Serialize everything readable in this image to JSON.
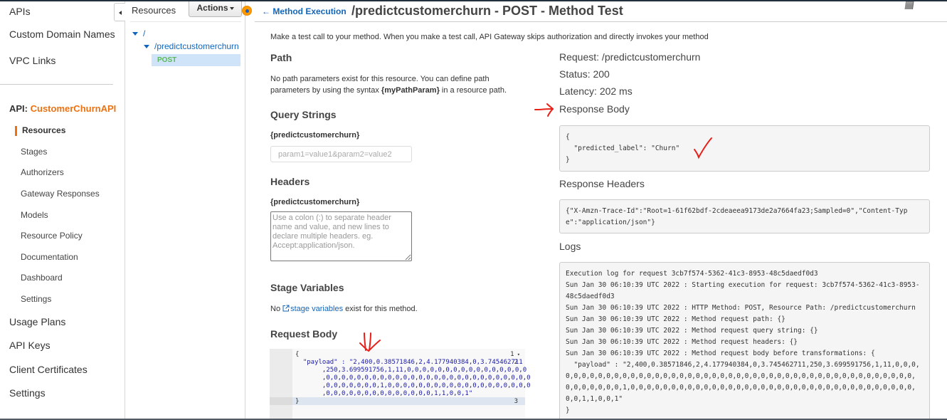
{
  "left_nav": {
    "top_items": [
      "APIs",
      "Custom Domain Names",
      "VPC Links"
    ],
    "api_prefix": "API:",
    "api_name": "CustomerChurnAPI",
    "sub_items": [
      "Resources",
      "Stages",
      "Authorizers",
      "Gateway Responses",
      "Models",
      "Resource Policy",
      "Documentation",
      "Dashboard",
      "Settings"
    ],
    "active_sub_item": "Resources",
    "bottom_items": [
      "Usage Plans",
      "API Keys",
      "Client Certificates",
      "Settings"
    ]
  },
  "resources_panel": {
    "title": "Resources",
    "actions_label": "Actions",
    "tree": [
      {
        "label": "/",
        "level": 0,
        "expanded": true
      },
      {
        "label": "/predictcustomerchurn",
        "level": 1,
        "expanded": true
      },
      {
        "label": "POST",
        "level": 2,
        "selected": true
      }
    ]
  },
  "header": {
    "back_label": "Method Execution",
    "title": "/predictcustomerchurn - POST - Method Test",
    "intro": "Make a test call to your method. When you make a test call, API Gateway skips authorization and directly invokes your method"
  },
  "form": {
    "path": {
      "heading": "Path",
      "text_before": "No path parameters exist for this resource. You can define path parameters by using the syntax ",
      "syntax": "{myPathParam}",
      "text_after": " in a resource path."
    },
    "query_strings": {
      "heading": "Query Strings",
      "resource": "{predictcustomerchurn}",
      "placeholder": "param1=value1&param2=value2",
      "value": ""
    },
    "headers": {
      "heading": "Headers",
      "resource": "{predictcustomerchurn}",
      "placeholder": "Use a colon (:) to separate header name and value, and new lines to declare multiple headers. eg. Accept:application/json.",
      "value": ""
    },
    "stage_variables": {
      "heading": "Stage Variables",
      "text_before": "No ",
      "link": "stage variables",
      "text_after": " exist for this method."
    },
    "request_body": {
      "heading": "Request Body",
      "line_numbers": [
        "1",
        "2",
        "3"
      ],
      "lines": [
        "{",
        "  \"payload\" : \"2,400,0.38571846,2,4.177940384,0,3.745462711",
        "       ,250,3.699591756,1,11,0,0,0,0,0,0,0,0,0,0,0,0,0,0,0,0",
        "       ,0,0,0,0,0,0,0,0,0,0,0,0,0,0,0,0,0,0,0,0,0,0,0,0,0,0,0",
        "       ,0,0,0,0,0,0,0,1,0,0,0,0,0,0,0,0,0,0,0,0,0,0,0,0,0,0,0",
        "       ,0,0,0,0,0,0,0,0,0,0,0,0,0,0,1,1,0,0,1\"",
        "}"
      ]
    }
  },
  "result": {
    "request": "Request: /predictcustomerchurn",
    "status": "Status: 200",
    "latency": "Latency: 202 ms",
    "response_body_heading": "Response Body",
    "response_body": "{\n  \"predicted_label\": \"Churn\"\n}",
    "response_headers_heading": "Response Headers",
    "response_headers": "{\"X-Amzn-Trace-Id\":\"Root=1-61f62bdf-2cdeaeea9173de2a7664fa23;Sampled=0\",\"Content-Type\":\"application/json\"}",
    "logs_heading": "Logs",
    "logs": "Execution log for request 3cb7f574-5362-41c3-8953-48c5daedf0d3\nSun Jan 30 06:10:39 UTC 2022 : Starting execution for request: 3cb7f574-5362-41c3-8953-48c5daedf0d3\nSun Jan 30 06:10:39 UTC 2022 : HTTP Method: POST, Resource Path: /predictcustomerchurn\nSun Jan 30 06:10:39 UTC 2022 : Method request path: {}\nSun Jan 30 06:10:39 UTC 2022 : Method request query string: {}\nSun Jan 30 06:10:39 UTC 2022 : Method request headers: {}\nSun Jan 30 06:10:39 UTC 2022 : Method request body before transformations: {\n  \"payload\" : \"2,400,0.38571846,2,4.177940384,0,3.745462711,250,3.699591756,1,11,0,0,0,0,0,0,0,0,0,0,0,0,0,0,0,0,0,0,0,0,0,0,0,0,0,0,0,0,0,0,0,0,0,0,0,0,0,0,0,0,0,0,0,0,0,0,0,0,0,0,0,0,0,1,0,0,0,0,0,0,0,0,0,0,0,0,0,0,0,0,0,0,0,0,0,0,0,0,0,0,0,0,0,0,0,0,0,0,0,0,0,1,1,0,0,1\"\n}"
  },
  "colors": {
    "accent_orange": "#ec7211",
    "link_blue": "#1166bb",
    "post_green": "#5cb85c",
    "annotation_red": "#e8201a"
  }
}
